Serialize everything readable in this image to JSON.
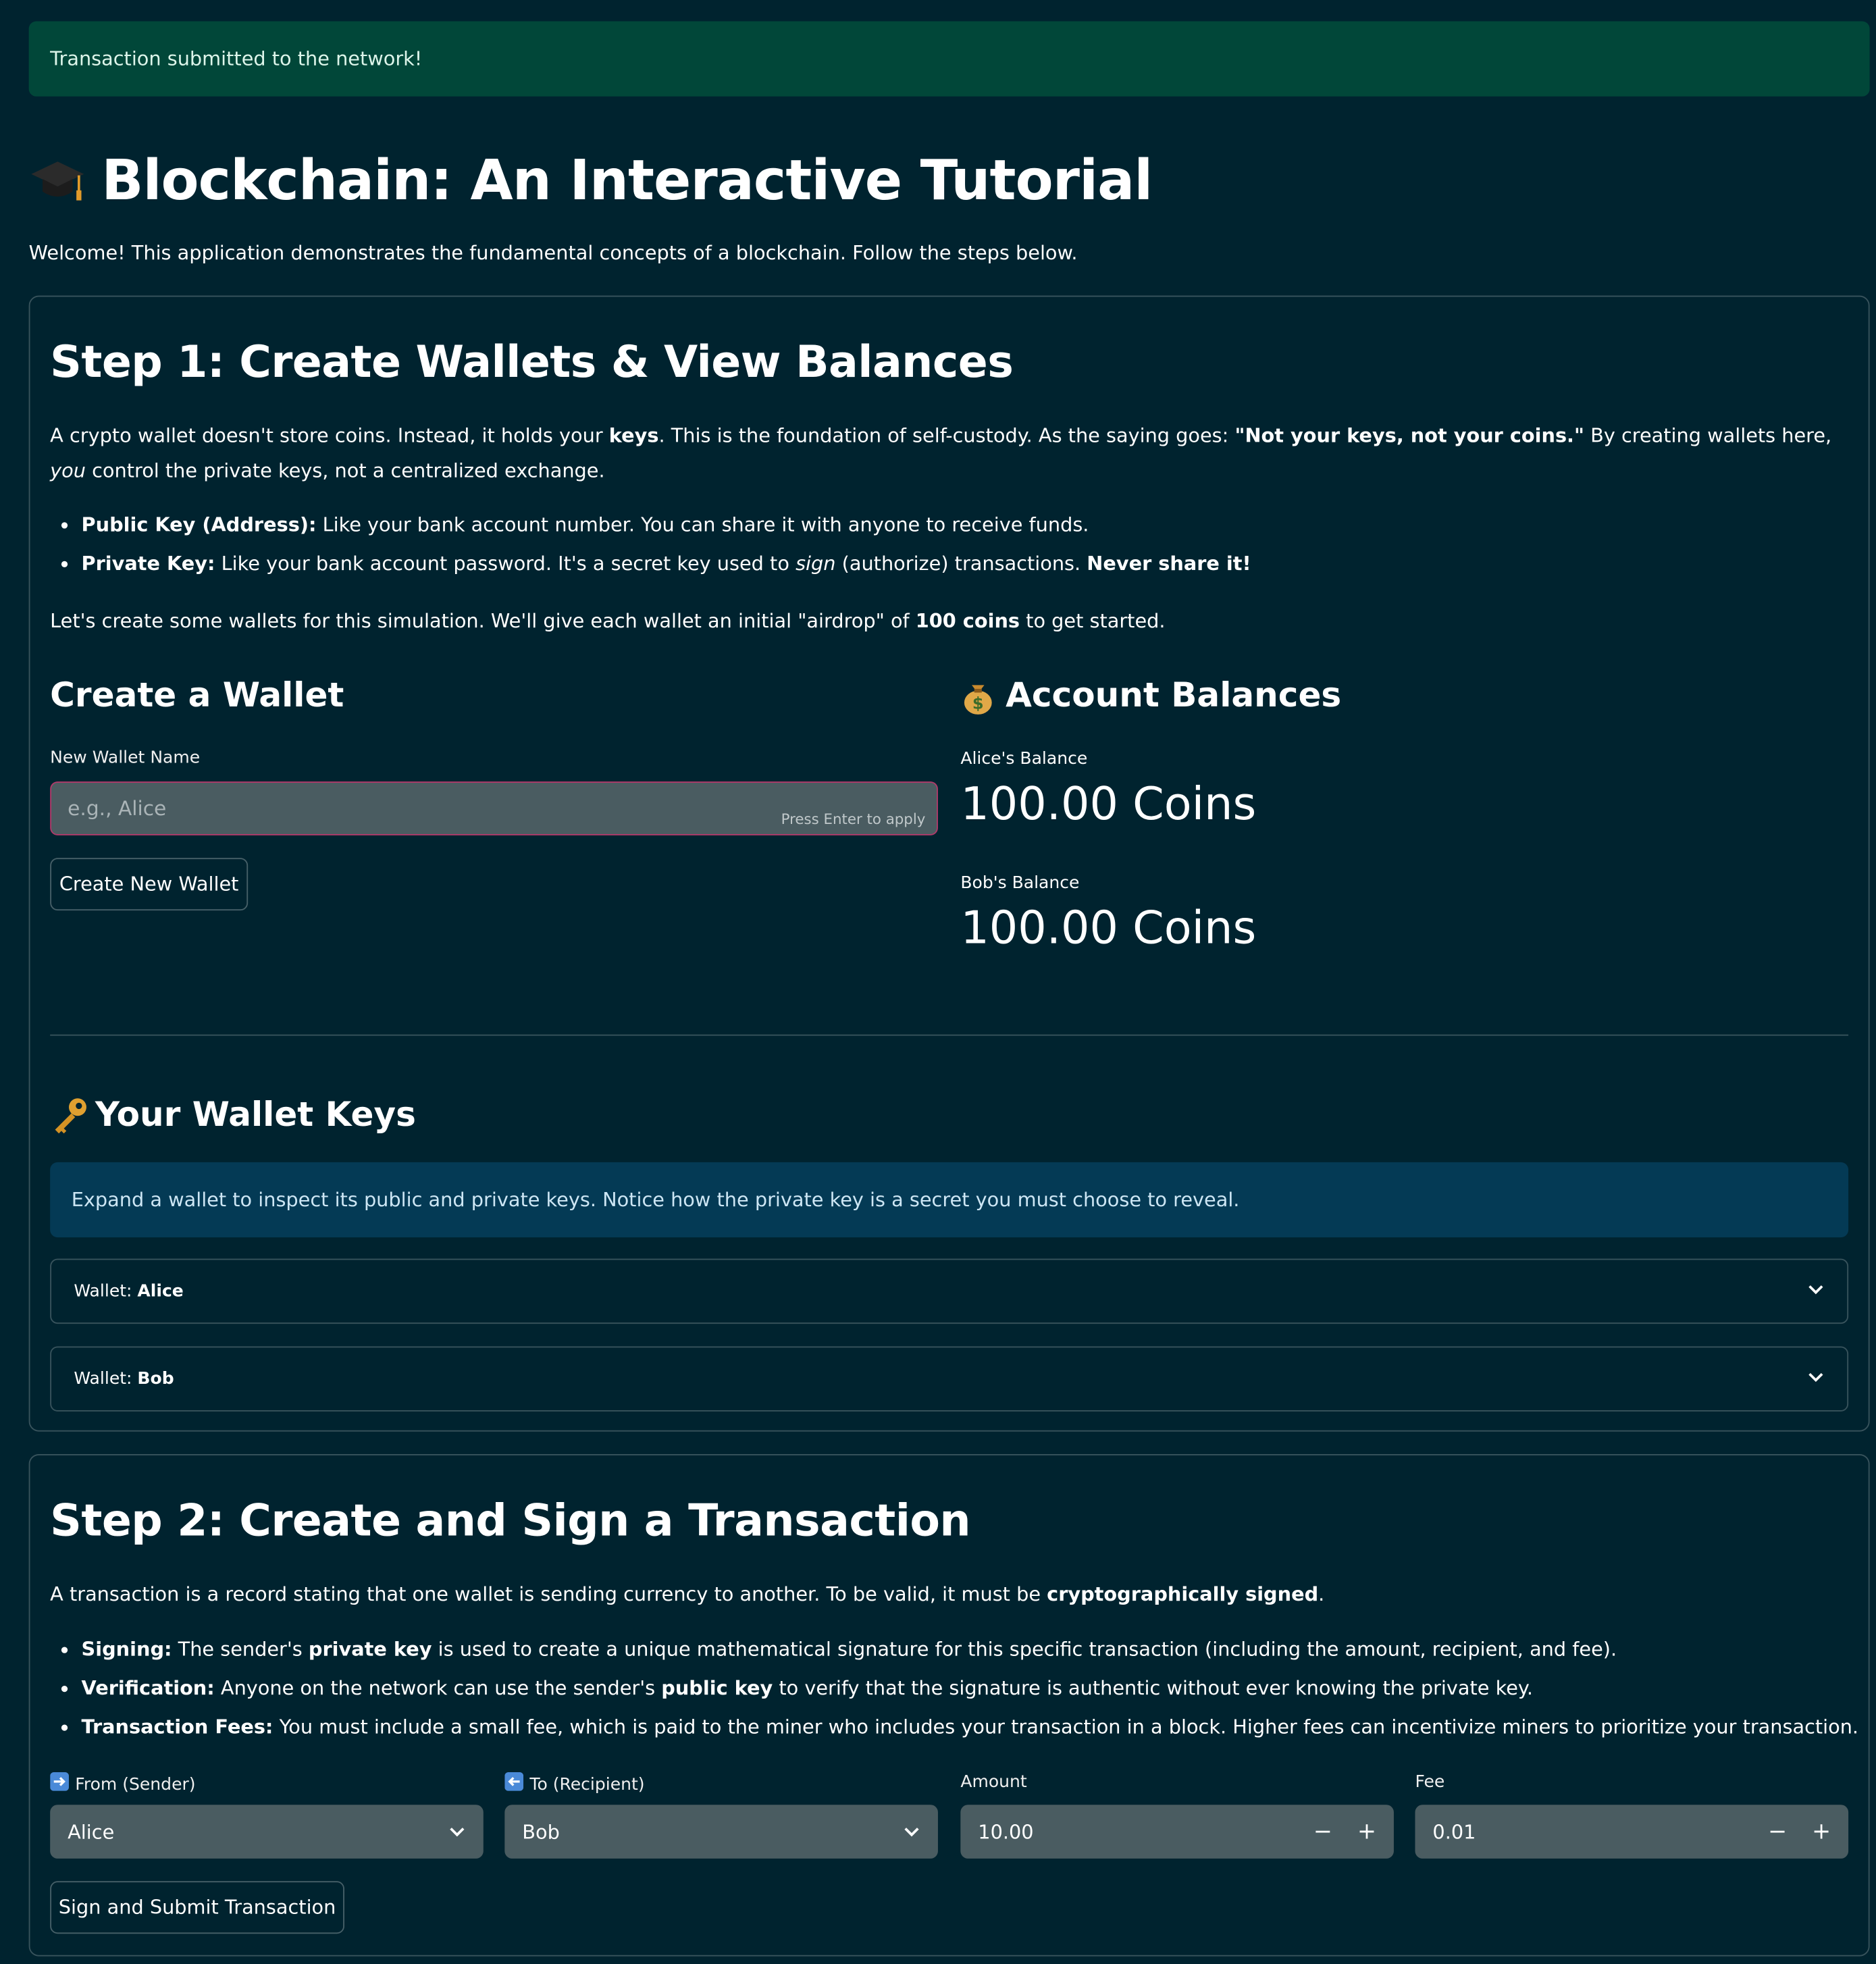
{
  "toast": "Transaction submitted to the network!",
  "title": "Blockchain: An Interactive Tutorial",
  "intro": "Welcome! This application demonstrates the fundamental concepts of a blockchain. Follow the steps below.",
  "step1": {
    "heading": "Step 1: Create Wallets & View Balances",
    "para1": {
      "a": "A crypto wallet doesn't store coins. Instead, it holds your ",
      "b": "keys",
      "c": ". This is the foundation of self-custody. As the saying goes: ",
      "d": "\"Not your keys, not your coins.\"",
      "e": " By creating wallets here, ",
      "f": "you",
      "g": " control the private keys, not a centralized exchange."
    },
    "bullets": [
      {
        "bold": "Public Key (Address):",
        "text": " Like your bank account number. You can share it with anyone to receive funds."
      },
      {
        "bold": "Private Key:",
        "text_a": " Like your bank account password. It's a secret key used to ",
        "italic": "sign",
        "text_b": " (authorize) transactions. ",
        "bold2": "Never share it!"
      }
    ],
    "para2": {
      "a": "Let's create some wallets for this simulation. We'll give each wallet an initial \"airdrop\" of ",
      "b": "100 coins",
      "c": " to get started."
    },
    "create_heading": "Create a Wallet",
    "input_label": "New Wallet Name",
    "input_placeholder": "e.g., Alice",
    "input_hint": "Press Enter to apply",
    "create_button": "Create New Wallet",
    "balances_heading": "Account Balances",
    "balances": [
      {
        "label": "Alice's Balance",
        "value": "100.00 Coins"
      },
      {
        "label": "Bob's Balance",
        "value": "100.00 Coins"
      }
    ],
    "keys_heading": "Your Wallet Keys",
    "keys_info": "Expand a wallet to inspect its public and private keys. Notice how the private key is a secret you must choose to reveal.",
    "wallets": [
      {
        "prefix": "Wallet: ",
        "name": "Alice"
      },
      {
        "prefix": "Wallet: ",
        "name": "Bob"
      }
    ]
  },
  "step2": {
    "heading": "Step 2: Create and Sign a Transaction",
    "para": {
      "a": "A transaction is a record stating that one wallet is sending currency to another. To be valid, it must be ",
      "b": "cryptographically signed",
      "c": "."
    },
    "bullets": [
      {
        "bold": "Signing:",
        "a": " The sender's ",
        "bold2": "private key",
        "b": " is used to create a unique mathematical signature for this specific transaction (including the amount, recipient, and fee)."
      },
      {
        "bold": "Verification:",
        "a": " Anyone on the network can use the sender's ",
        "bold2": "public key",
        "b": " to verify that the signature is authentic without ever knowing the private key."
      },
      {
        "bold": "Transaction Fees:",
        "a": " You must include a small fee, which is paid to the miner who includes your transaction in a block. Higher fees can incentivize miners to prioritize your transaction."
      }
    ],
    "from_label": "From (Sender)",
    "from_value": "Alice",
    "to_label": "To (Recipient)",
    "to_value": "Bob",
    "amount_label": "Amount",
    "amount_value": "10.00",
    "fee_label": "Fee",
    "fee_value": "0.01",
    "submit_button": "Sign and Submit Transaction"
  }
}
